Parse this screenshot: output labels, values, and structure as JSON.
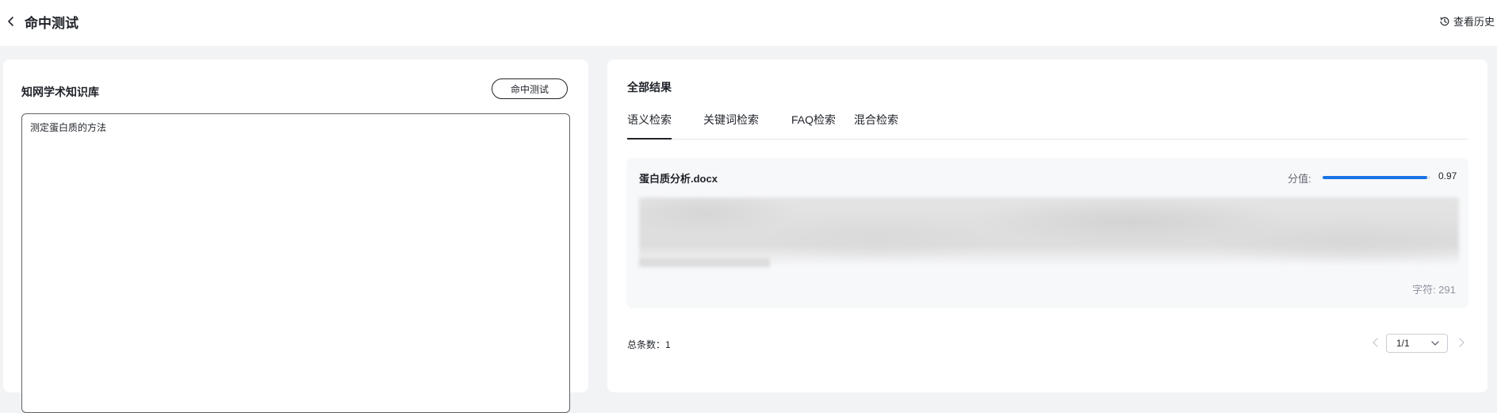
{
  "header": {
    "title": "命中测试",
    "history_label": "查看历史"
  },
  "left_panel": {
    "kb_name": "知网学术知识库",
    "test_button_label": "命中测试",
    "query_value": "测定蛋白质的方法"
  },
  "right_panel": {
    "title": "全部结果",
    "tabs": [
      {
        "label": "语义检索",
        "active": true
      },
      {
        "label": "关键词检索",
        "active": false
      },
      {
        "label": "FAQ检索",
        "active": false
      },
      {
        "label": "混合检索",
        "active": false
      }
    ],
    "result": {
      "doc_name": "蛋白质分析.docx",
      "score_label": "分值:",
      "score_value": "0.97",
      "score": 0.97,
      "char_count": "字符: 291"
    },
    "total_label": "总条数：1",
    "page_select": "1/1"
  },
  "colors": {
    "accent": "#1a73e8",
    "background": "#f2f3f5",
    "card": "#f7f8fa"
  },
  "icons": {
    "back": "chevron-left-icon",
    "history": "history-clock-icon",
    "prev": "chevron-left-icon",
    "next": "chevron-right-icon",
    "select": "chevron-down-icon"
  }
}
